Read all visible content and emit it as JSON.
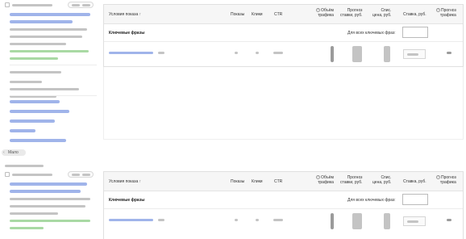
{
  "columns": {
    "conditions": "Условия показа ↑",
    "shows": "Показы",
    "clicks": "Клики",
    "ctr": "CTR",
    "traffic_volume_line1": "Объём",
    "traffic_volume_line2": "трафика",
    "forecast_bid_line1": "Прогноз",
    "forecast_bid_line2": "ставки, руб.",
    "charged_price_line1": "Спис.",
    "charged_price_line2": "цена, руб.",
    "bid": "Ставка, руб.",
    "forecast_traffic_line1": "Прогноз",
    "forecast_traffic_line2": "трафика",
    "help_icon": "?"
  },
  "keyphrases_label": "Ключевые фразы",
  "for_all_phrases_label": "Для всех ключевых фраз:",
  "more_button_label": "Мало",
  "groups": [
    {
      "name": "group-1",
      "forecast_traffic": ""
    },
    {
      "name": "group-2",
      "forecast_traffic": ""
    }
  ],
  "icons": {
    "help": "help-icon",
    "checkbox": "checkbox-icon",
    "arrow": "chevron-left-icon"
  },
  "colors": {
    "header_bg": "#f6f6f6",
    "blurred_link": "#8fa7e6",
    "blurred_green": "#a9d9a4"
  }
}
